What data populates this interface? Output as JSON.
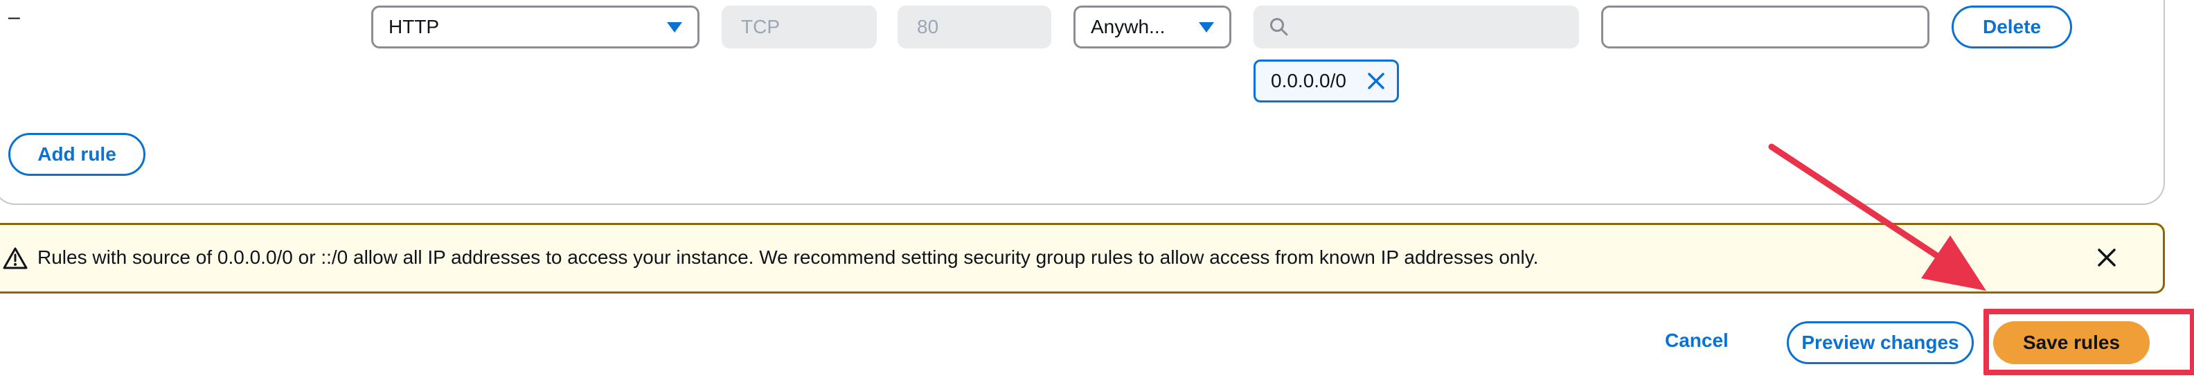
{
  "rule": {
    "type_value": "HTTP",
    "protocol_value": "TCP",
    "port_value": "80",
    "source_value": "Anywh...",
    "source_search_placeholder": "",
    "source_token": "0.0.0.0/0",
    "description_value": "",
    "delete_label": "Delete",
    "dash": "–"
  },
  "add_rule_label": "Add rule",
  "warning": {
    "icon": "warning-triangle-icon",
    "text": "Rules with source of 0.0.0.0/0 or ::/0 allow all IP addresses to access your instance. We recommend setting security group rules to allow access from known IP addresses only."
  },
  "footer": {
    "cancel_label": "Cancel",
    "preview_label": "Preview changes",
    "save_label": "Save rules"
  },
  "annotation": {
    "color": "#e8334a",
    "target": "save-rules-button"
  }
}
